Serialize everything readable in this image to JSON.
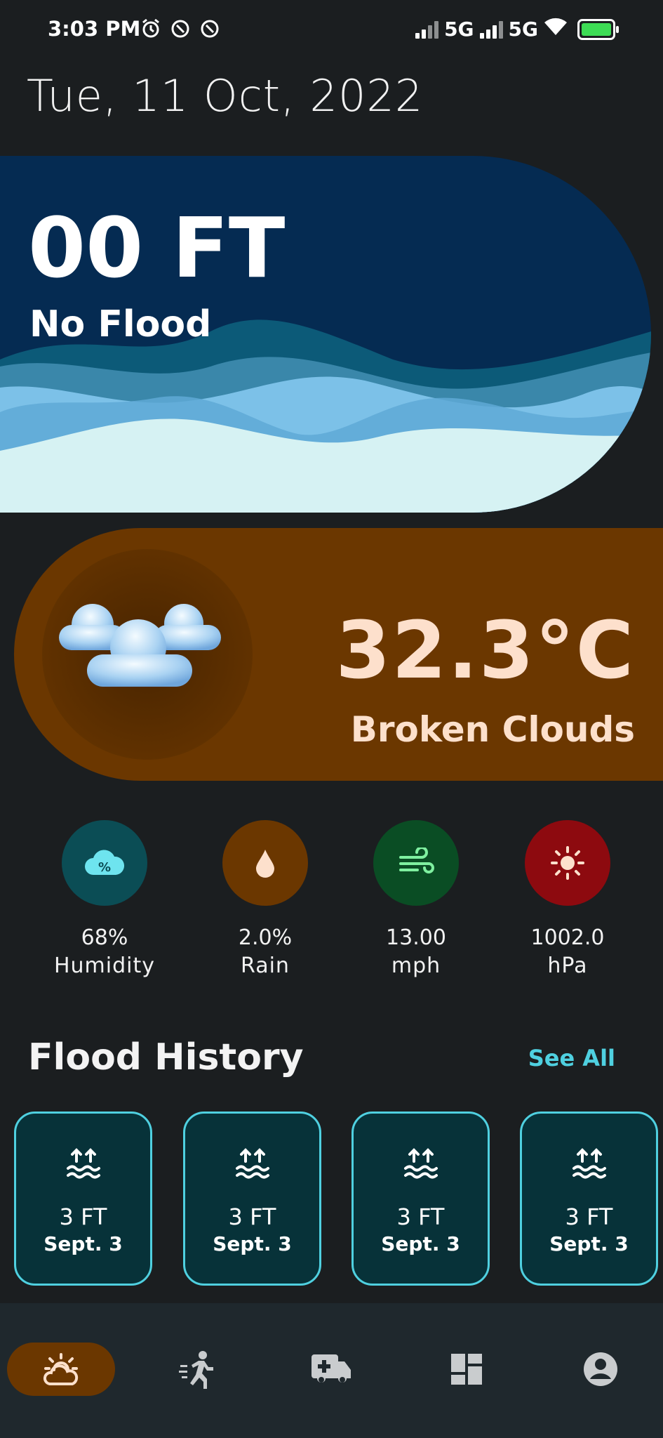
{
  "status_bar": {
    "time": "3:03 PM",
    "network_1": "5G",
    "network_2": "5G",
    "icons": [
      "alarm-icon",
      "sync-icon",
      "sync-icon",
      "signal-icon",
      "signal-icon",
      "wifi-icon",
      "battery-icon"
    ]
  },
  "date": "Tue, 11 Oct, 2022",
  "flood": {
    "level": "00 FT",
    "status": "No Flood",
    "colors": {
      "card": "#052b52",
      "wave_light": "#d6f2f3",
      "wave_mid": "#7cc1e8"
    }
  },
  "weather": {
    "temperature": "32.3°C",
    "condition": "Broken Clouds",
    "icon": "clouds-icon",
    "card_color": "#6b3700"
  },
  "stats": [
    {
      "value": "68%",
      "label": "Humidity",
      "icon": "humidity-icon",
      "color": "#0b4d55"
    },
    {
      "value": "2.0%",
      "label": "Rain",
      "icon": "raindrop-icon",
      "color": "#6b3700"
    },
    {
      "value": "13.00",
      "label": "mph",
      "icon": "wind-icon",
      "color": "#0a4d24"
    },
    {
      "value": "1002.0",
      "label": "hPa",
      "icon": "sun-icon",
      "color": "#8d0a0f"
    }
  ],
  "history": {
    "title": "Flood History",
    "see_all": "See All",
    "items": [
      {
        "level": "3 FT",
        "date": "Sept. 3"
      },
      {
        "level": "3 FT",
        "date": "Sept. 3"
      },
      {
        "level": "3 FT",
        "date": "Sept. 3"
      },
      {
        "level": "3 FT",
        "date": "Sept. 3"
      }
    ]
  },
  "nav": {
    "items": [
      "weather-icon",
      "evacuate-icon",
      "ambulance-icon",
      "dashboard-icon",
      "profile-icon"
    ],
    "active": "weather-icon"
  }
}
